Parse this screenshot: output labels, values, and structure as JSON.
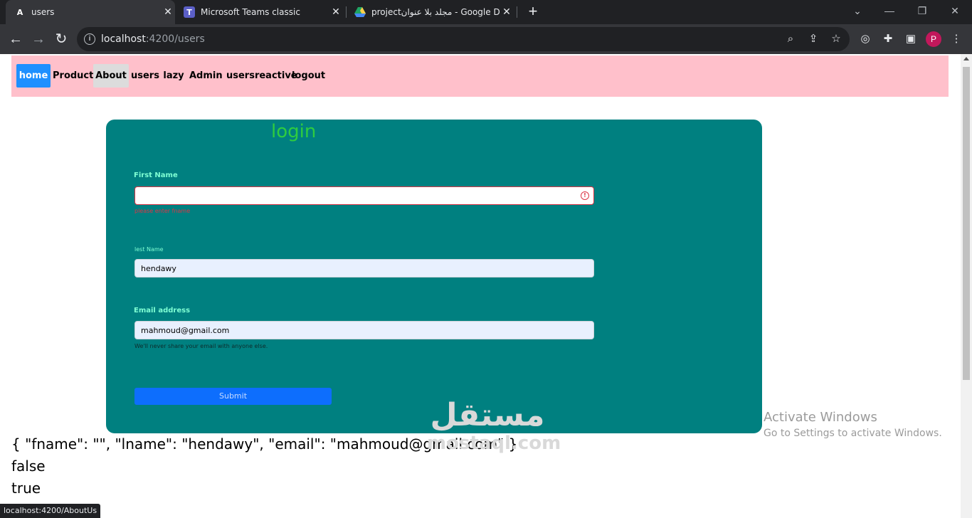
{
  "browser": {
    "tabs": [
      {
        "label": "users",
        "icon": "angular-icon",
        "active": true
      },
      {
        "label": "Microsoft Teams classic",
        "icon": "teams-icon",
        "active": false
      },
      {
        "label": "projectمجلد بلا عنوان - Google Dr",
        "icon": "google-drive-icon",
        "active": false
      }
    ],
    "url_host": "localhost",
    "url_rest": ":4200/users",
    "profile_initial": "P",
    "status_url": "localhost:4200/AboutUs"
  },
  "navbar": {
    "bg_color": "#ffc0cb",
    "items": [
      {
        "label": "home",
        "state": "active"
      },
      {
        "label": "Product",
        "state": ""
      },
      {
        "label": "About",
        "state": "hover"
      },
      {
        "label": "users",
        "state": ""
      },
      {
        "label": "lazy",
        "state": ""
      },
      {
        "label": "Admin",
        "state": ""
      },
      {
        "label": "usersreactive",
        "state": ""
      },
      {
        "label": "logout",
        "state": ""
      }
    ]
  },
  "form": {
    "title": "login",
    "card_color": "#008080",
    "first_name": {
      "label": "First Name",
      "value": "",
      "error": "please enter fname"
    },
    "last_name": {
      "label": "lest Name",
      "value": "hendawy"
    },
    "email": {
      "label": "Email address",
      "value": "mahmoud@gmail.com",
      "help": "We'll never share your email with anyone else."
    },
    "submit_label": "Submit"
  },
  "output": {
    "json_line": "{ \"fname\": \"\", \"lname\": \"hendawy\", \"email\": \"mahmoud@gmail.com\" }",
    "line2": "false",
    "line3": "true"
  },
  "watermark": {
    "arabic": "مستقل",
    "latin": "mostaql.com"
  },
  "activation": {
    "title": "Activate Windows",
    "subtitle": "Go to Settings to activate Windows."
  }
}
